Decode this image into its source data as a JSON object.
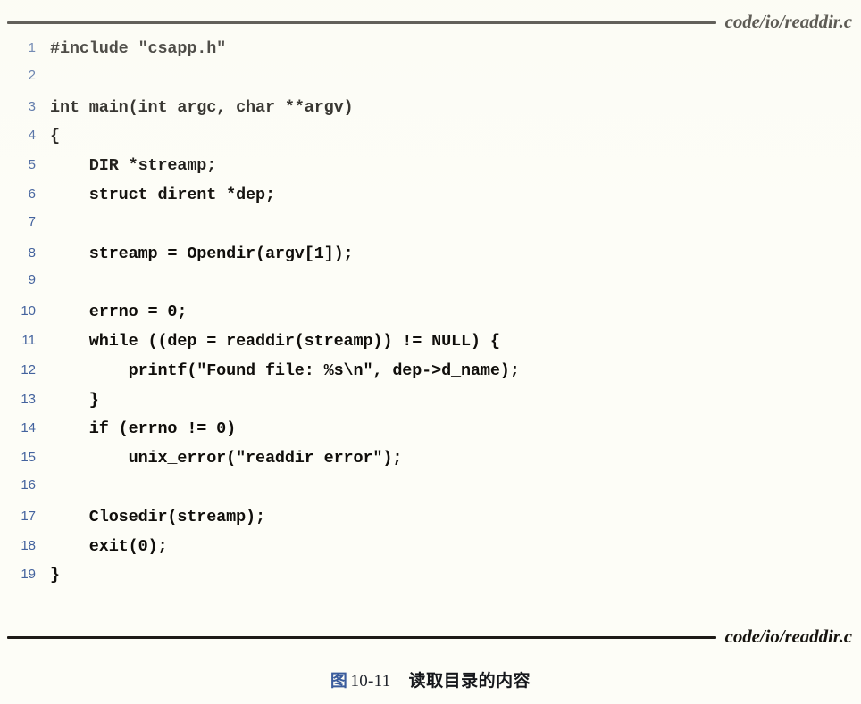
{
  "figure": {
    "top_file_label": "code/io/readdir.c",
    "bottom_file_label": "code/io/readdir.c",
    "caption_figure_word": "图",
    "caption_number": "10-11",
    "caption_title": "读取目录的内容",
    "accent_line_number_color": "#44639e",
    "accent_caption_color": "#3a5c9c",
    "rule_color": "#1d1a17",
    "page_background": "#fdfdf7"
  },
  "code": {
    "language": "c",
    "first_line_number": 1,
    "last_line_number": 19,
    "lines": [
      {
        "n": "1",
        "text": "#include \"csapp.h\""
      },
      {
        "n": "2",
        "text": ""
      },
      {
        "n": "3",
        "text": "int main(int argc, char **argv)"
      },
      {
        "n": "4",
        "text": "{"
      },
      {
        "n": "5",
        "text": "    DIR *streamp;"
      },
      {
        "n": "6",
        "text": "    struct dirent *dep;"
      },
      {
        "n": "7",
        "text": ""
      },
      {
        "n": "8",
        "text": "    streamp = Opendir(argv[1]);"
      },
      {
        "n": "9",
        "text": ""
      },
      {
        "n": "10",
        "text": "    errno = 0;"
      },
      {
        "n": "11",
        "text": "    while ((dep = readdir(streamp)) != NULL) {"
      },
      {
        "n": "12",
        "text": "        printf(\"Found file: %s\\n\", dep->d_name);"
      },
      {
        "n": "13",
        "text": "    }"
      },
      {
        "n": "14",
        "text": "    if (errno != 0)"
      },
      {
        "n": "15",
        "text": "        unix_error(\"readdir error\");"
      },
      {
        "n": "16",
        "text": ""
      },
      {
        "n": "17",
        "text": "    Closedir(streamp);"
      },
      {
        "n": "18",
        "text": "    exit(0);"
      },
      {
        "n": "19",
        "text": "}"
      }
    ]
  }
}
